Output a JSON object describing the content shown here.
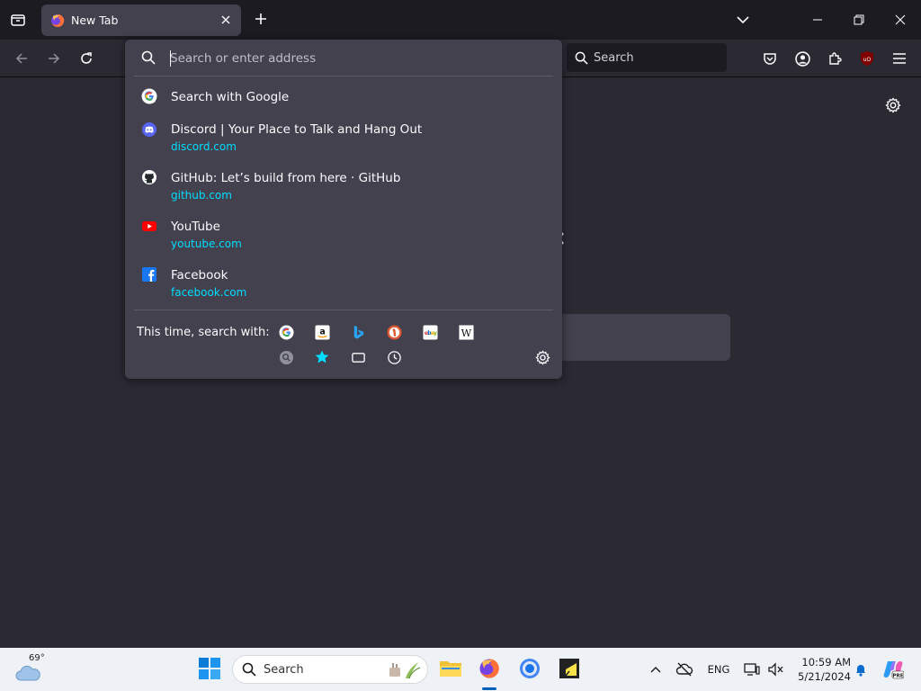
{
  "tab": {
    "title": "New Tab"
  },
  "toolbar": {
    "search_label": "Search"
  },
  "urlbar": {
    "placeholder": "Search or enter address"
  },
  "suggestions": [
    {
      "title": "Search with Google",
      "url": "",
      "icon": "google-icon"
    },
    {
      "title": "Discord | Your Place to Talk and Hang Out",
      "url": "discord.com",
      "icon": "discord-icon"
    },
    {
      "title": "GitHub: Let’s build from here · GitHub",
      "url": "github.com",
      "icon": "github-icon"
    },
    {
      "title": "YouTube",
      "url": "youtube.com",
      "icon": "youtube-icon"
    },
    {
      "title": "Facebook",
      "url": "facebook.com",
      "icon": "facebook-icon"
    }
  ],
  "oneoff": {
    "label": "This time, search with:",
    "engines": [
      "google-icon",
      "amazon-icon",
      "bing-icon",
      "duckduckgo-icon",
      "ebay-icon",
      "wikipedia-icon"
    ],
    "modes": [
      "search-icon",
      "bookmarks-star-icon",
      "tabs-icon",
      "history-clock-icon"
    ]
  },
  "taskbar": {
    "weather_temp": "69°",
    "search_label": "Search",
    "language": "ENG",
    "time": "10:59 AM",
    "date": "5/21/2024"
  },
  "colors": {
    "frame": "#1c1b22",
    "toolbar": "#2b2a33",
    "panel": "#42414d",
    "url_link": "#00ddff",
    "taskbar": "#eef1f5"
  }
}
